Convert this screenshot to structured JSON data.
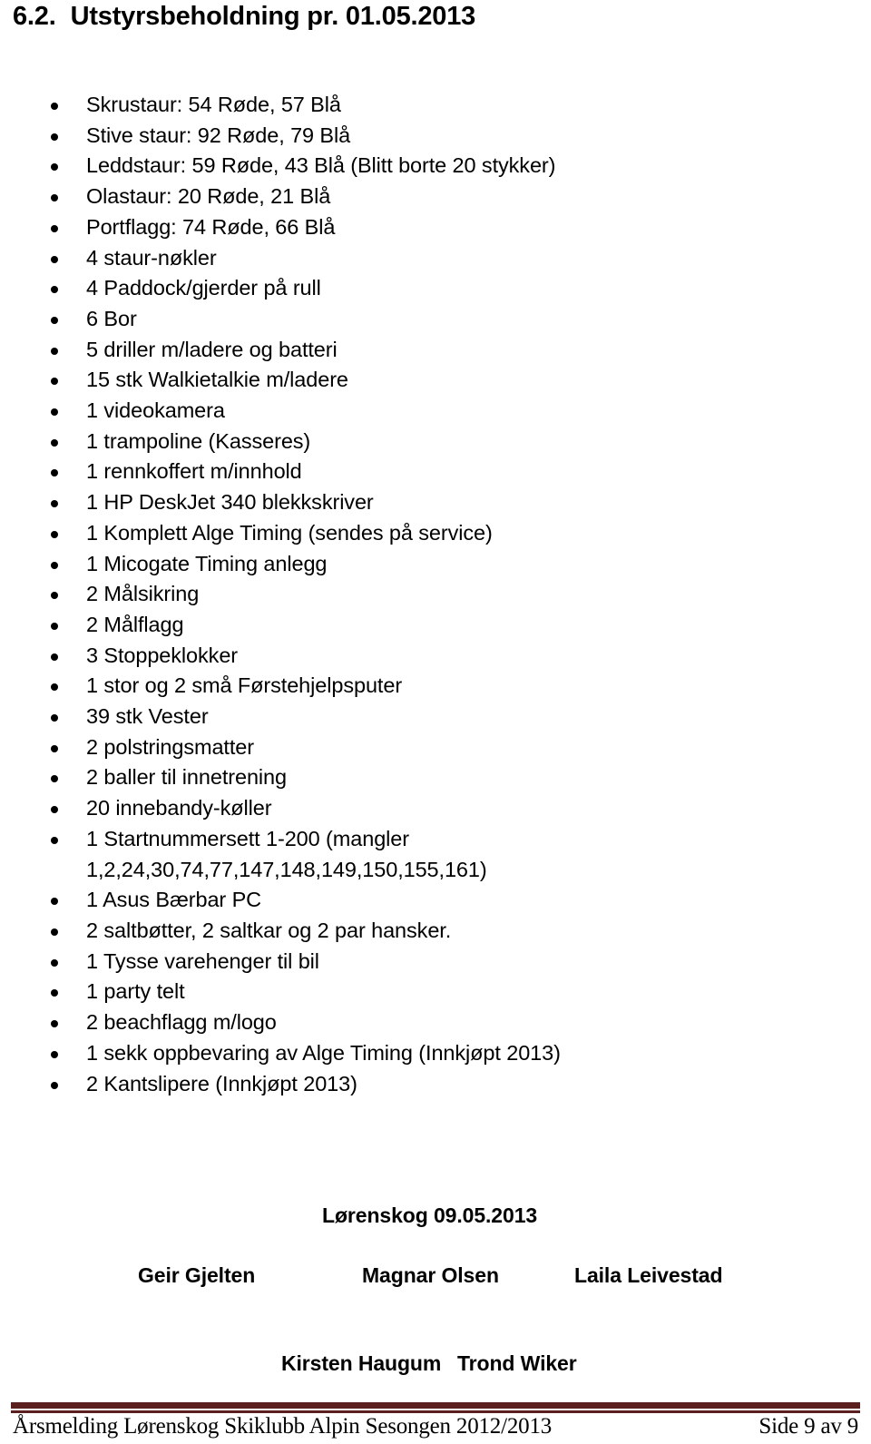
{
  "heading": {
    "number": "6.2.",
    "title": "Utstyrsbeholdning pr. 01.05.2013"
  },
  "equipment_list": [
    {
      "text": "Skrustaur: 54 Røde, 57 Blå"
    },
    {
      "text": "Stive staur: 92 Røde, 79 Blå"
    },
    {
      "text": "Leddstaur: 59 Røde, 43 Blå (Blitt borte 20 stykker)"
    },
    {
      "text": "Olastaur: 20 Røde, 21 Blå"
    },
    {
      "text": "Portflagg: 74 Røde, 66 Blå"
    },
    {
      "text": "4 staur-nøkler"
    },
    {
      "text": "4 Paddock/gjerder på rull"
    },
    {
      "text": "6 Bor"
    },
    {
      "text": "5 driller m/ladere og batteri"
    },
    {
      "text": "15 stk Walkietalkie m/ladere"
    },
    {
      "text": "1 videokamera"
    },
    {
      "text": "1 trampoline (Kasseres)"
    },
    {
      "text": "1 rennkoffert m/innhold"
    },
    {
      "text": "1 HP DeskJet 340 blekkskriver"
    },
    {
      "text": "1 Komplett Alge Timing (sendes på service)"
    },
    {
      "text": "1 Micogate Timing anlegg"
    },
    {
      "text": "2 Målsikring"
    },
    {
      "text": "2 Målflagg"
    },
    {
      "text": "3 Stoppeklokker"
    },
    {
      "text": "1 stor og 2 små Førstehjelpsputer"
    },
    {
      "text": "39 stk Vester"
    },
    {
      "text": "2 polstringsmatter"
    },
    {
      "text": "2 baller til innetrening"
    },
    {
      "text": "20 innebandy-køller"
    },
    {
      "text": "1 Startnummersett 1-200 (mangler\n1,2,24,30,74,77,147,148,149,150,155,161)"
    },
    {
      "text": "1 Asus Bærbar PC"
    },
    {
      "text": "2 saltbøtter, 2 saltkar og 2 par hansker."
    },
    {
      "text": "1 Tysse varehenger til bil"
    },
    {
      "text": "1 party telt"
    },
    {
      "text": "2 beachflagg m/logo"
    },
    {
      "text": "1 sekk oppbevaring av Alge Timing (Innkjøpt 2013)"
    },
    {
      "text": "2 Kantslipere (Innkjøpt 2013)"
    }
  ],
  "signature": {
    "place_date": "Lørenskog 09.05.2013",
    "row1": [
      {
        "name": "Geir Gjelten"
      },
      {
        "name": "Magnar Olsen"
      },
      {
        "name": "Laila Leivestad"
      }
    ],
    "row2": [
      {
        "name": "Kirsten Haugum"
      },
      {
        "name": "Trond Wiker"
      }
    ]
  },
  "footer": {
    "left_text": "Årsmelding Lørenskog Skiklubb Alpin Sesongen 2012/2013",
    "page_text": "Side 9 av 9",
    "rule_color": "#5b1f1f"
  }
}
